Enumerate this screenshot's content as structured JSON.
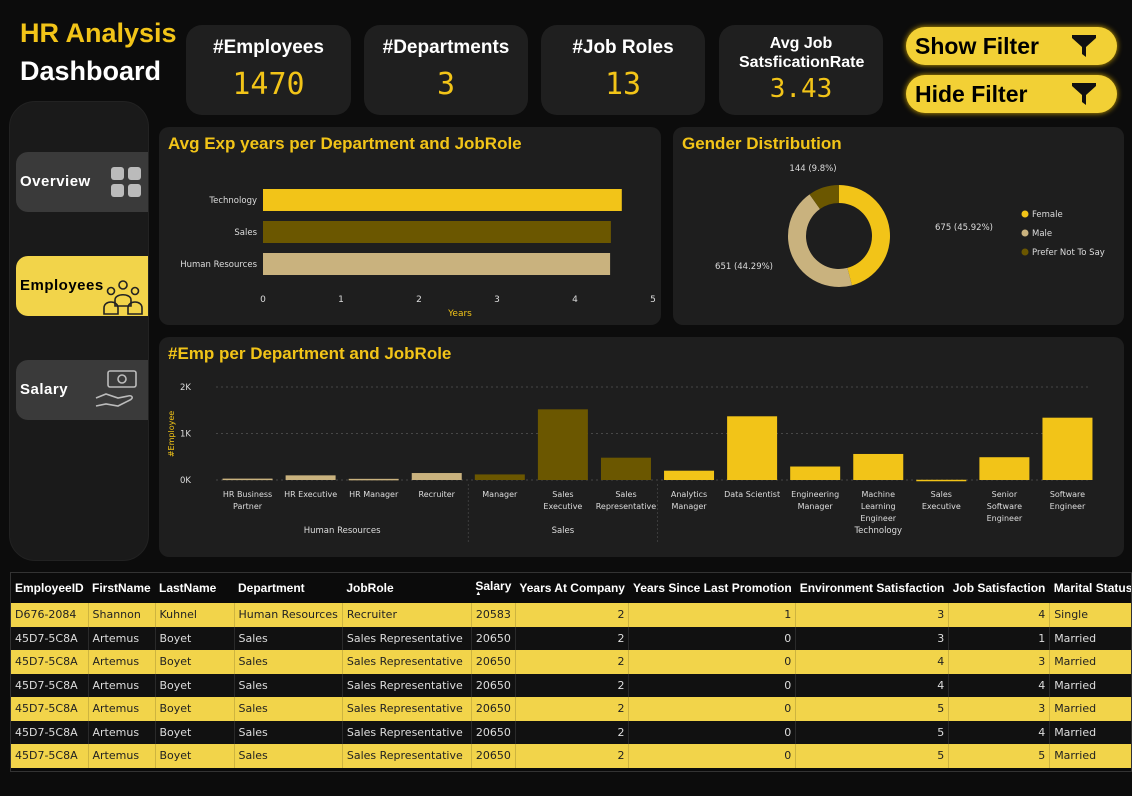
{
  "header": {
    "title_line1": "HR Analysis",
    "title_line2": "Dashboard"
  },
  "kpis": [
    {
      "label": "#Employees",
      "value": "1470"
    },
    {
      "label": "#Departments",
      "value": "3"
    },
    {
      "label": "#Job Roles",
      "value": "13"
    },
    {
      "label": "Avg Job SatsficationRate",
      "value": "3.43"
    }
  ],
  "filters": {
    "show_label": "Show Filter",
    "hide_label": "Hide Filter"
  },
  "nav": {
    "overview": "Overview",
    "employees": "Employees",
    "salary": "Salary",
    "active": "employees"
  },
  "colors": {
    "accent": "#f2c418",
    "dark_gold": "#6b5700",
    "tan": "#c9b27e",
    "panel": "#1e1e1e"
  },
  "exp_chart": {
    "title": "Avg Exp years per Department and JobRole",
    "chart_data": {
      "type": "bar",
      "orientation": "horizontal",
      "categories": [
        "Technology",
        "Sales",
        "Human Resources"
      ],
      "values": [
        4.6,
        4.46,
        4.45
      ],
      "colors": [
        "#f2c418",
        "#6b5700",
        "#c9b27e"
      ],
      "xlabel": "Years",
      "ylabel": "",
      "xlim": [
        0,
        5
      ],
      "xticks": [
        "0",
        "1",
        "2",
        "3",
        "4",
        "5"
      ]
    }
  },
  "gender_chart": {
    "title": "Gender Distribution",
    "chart_data": {
      "type": "pie",
      "donut": true,
      "labels": [
        "Female",
        "Male",
        "Prefer Not To Say"
      ],
      "values": [
        675,
        651,
        144
      ],
      "data_labels": [
        "675 (45.92%)",
        "651 (44.29%)",
        "144 (9.8%)"
      ],
      "colors": [
        "#f2c418",
        "#c9b27e",
        "#6b5700"
      ],
      "legend": "right"
    }
  },
  "emp_chart": {
    "title": "#Emp per Department and JobRole",
    "chart_data": {
      "type": "bar",
      "ylabel": "#Employee",
      "ylim": [
        0,
        2000
      ],
      "yticks": [
        "0K",
        "1K",
        "2K"
      ],
      "categories": [
        "HR Business Partner",
        "HR Executive",
        "HR Manager",
        "Recruiter",
        "Manager",
        "Sales Executive",
        "Sales Representative",
        "Analytics Manager",
        "Data Scientist",
        "Engineering Manager",
        "Machine Learning Engineer",
        "Sales Executive",
        "Senior Software Engineer",
        "Software Engineer"
      ],
      "category_lines": [
        [
          "HR Business",
          "Partner"
        ],
        [
          "HR Executive"
        ],
        [
          "HR Manager"
        ],
        [
          "Recruiter"
        ],
        [
          "Manager"
        ],
        [
          "Sales",
          "Executive"
        ],
        [
          "Sales",
          "Representative"
        ],
        [
          "Analytics",
          "Manager"
        ],
        [
          "Data Scientist"
        ],
        [
          "Engineering",
          "Manager"
        ],
        [
          "Machine",
          "Learning",
          "Engineer"
        ],
        [
          "Sales",
          "Executive"
        ],
        [
          "Senior",
          "Software",
          "Engineer"
        ],
        [
          "Software",
          "Engineer"
        ]
      ],
      "groups": [
        "Human Resources",
        "Human Resources",
        "Human Resources",
        "Human Resources",
        "Sales",
        "Sales",
        "Sales",
        "Technology",
        "Technology",
        "Technology",
        "Technology",
        "Technology",
        "Technology",
        "Technology"
      ],
      "group_labels": [
        {
          "name": "Human Resources",
          "start": 0,
          "end": 3
        },
        {
          "name": "Sales",
          "start": 4,
          "end": 6
        },
        {
          "name": "Technology",
          "start": 7,
          "end": 13
        }
      ],
      "values": [
        30,
        100,
        25,
        150,
        120,
        1520,
        480,
        200,
        1370,
        290,
        560,
        5,
        490,
        1340
      ]
    }
  },
  "table": {
    "columns": [
      "EmployeeID",
      "FirstName",
      "LastName",
      "Department",
      "JobRole",
      "Salary",
      "Years At Company",
      "Years Since Last Promotion",
      "Environment Satisfaction",
      "Job Satisfaction",
      "Marital Status"
    ],
    "sorted_column": "Salary",
    "rows": [
      [
        "D676-2084",
        "Shannon",
        "Kuhnel",
        "Human Resources",
        "Recruiter",
        "20583",
        "2",
        "1",
        "3",
        "4",
        "Single"
      ],
      [
        "45D7-5C8A",
        "Artemus",
        "Boyet",
        "Sales",
        "Sales Representative",
        "20650",
        "2",
        "0",
        "3",
        "1",
        "Married"
      ],
      [
        "45D7-5C8A",
        "Artemus",
        "Boyet",
        "Sales",
        "Sales Representative",
        "20650",
        "2",
        "0",
        "4",
        "3",
        "Married"
      ],
      [
        "45D7-5C8A",
        "Artemus",
        "Boyet",
        "Sales",
        "Sales Representative",
        "20650",
        "2",
        "0",
        "4",
        "4",
        "Married"
      ],
      [
        "45D7-5C8A",
        "Artemus",
        "Boyet",
        "Sales",
        "Sales Representative",
        "20650",
        "2",
        "0",
        "5",
        "3",
        "Married"
      ],
      [
        "45D7-5C8A",
        "Artemus",
        "Boyet",
        "Sales",
        "Sales Representative",
        "20650",
        "2",
        "0",
        "5",
        "4",
        "Married"
      ],
      [
        "45D7-5C8A",
        "Artemus",
        "Boyet",
        "Sales",
        "Sales Representative",
        "20650",
        "2",
        "0",
        "5",
        "5",
        "Married"
      ]
    ]
  },
  "icons": [
    "funnel-icon",
    "grid-apps-icon",
    "people-group-icon",
    "money-hand-icon",
    "sort-asc-icon"
  ]
}
